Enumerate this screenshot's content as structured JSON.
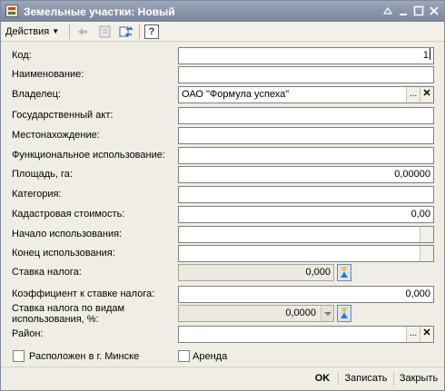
{
  "window": {
    "title": "Земельные участки: Новый"
  },
  "toolbar": {
    "actions_label": "Действия",
    "help_label": "?"
  },
  "form": {
    "code": {
      "label": "Код:",
      "value": "1"
    },
    "name": {
      "label": "Наименование:",
      "value": ""
    },
    "owner": {
      "label": "Владелец:",
      "value": "ОАО \"Формула успеха\""
    },
    "state_act": {
      "label": "Государственный акт:",
      "value": ""
    },
    "location": {
      "label": "Местонахождение:",
      "value": ""
    },
    "functional_use": {
      "label": "Функциональное использование:",
      "value": ""
    },
    "area": {
      "label": "Площадь, га:",
      "value": "0,00000"
    },
    "category": {
      "label": "Категория:",
      "value": ""
    },
    "cadastral_value": {
      "label": "Кадастровая стоимость:",
      "value": "0,00"
    },
    "use_start": {
      "label": "Начало использования:",
      "value": " .  ."
    },
    "use_end": {
      "label": "Конец использования:",
      "value": " .  ."
    },
    "tax_rate": {
      "label": "Ставка налога:",
      "value": "0,000"
    },
    "tax_coefficient": {
      "label": "Коэффициент к ставке налога:",
      "value": "0,000"
    },
    "tax_rate_by_use": {
      "label": "Ставка налога по видам использования, %:",
      "value": "0,0000"
    },
    "district": {
      "label": "Район:",
      "value": ""
    },
    "in_minsk": {
      "label": "Расположен в г. Минске",
      "checked": false
    },
    "lease": {
      "label": "Аренда",
      "checked": false
    }
  },
  "footer": {
    "ok_label": "OK",
    "save_label": "Записать",
    "close_label": "Закрыть"
  },
  "colors": {
    "titlebar": "#8a94a8",
    "window_bg": "#f0eee4",
    "accent": "#1d3c8a"
  }
}
